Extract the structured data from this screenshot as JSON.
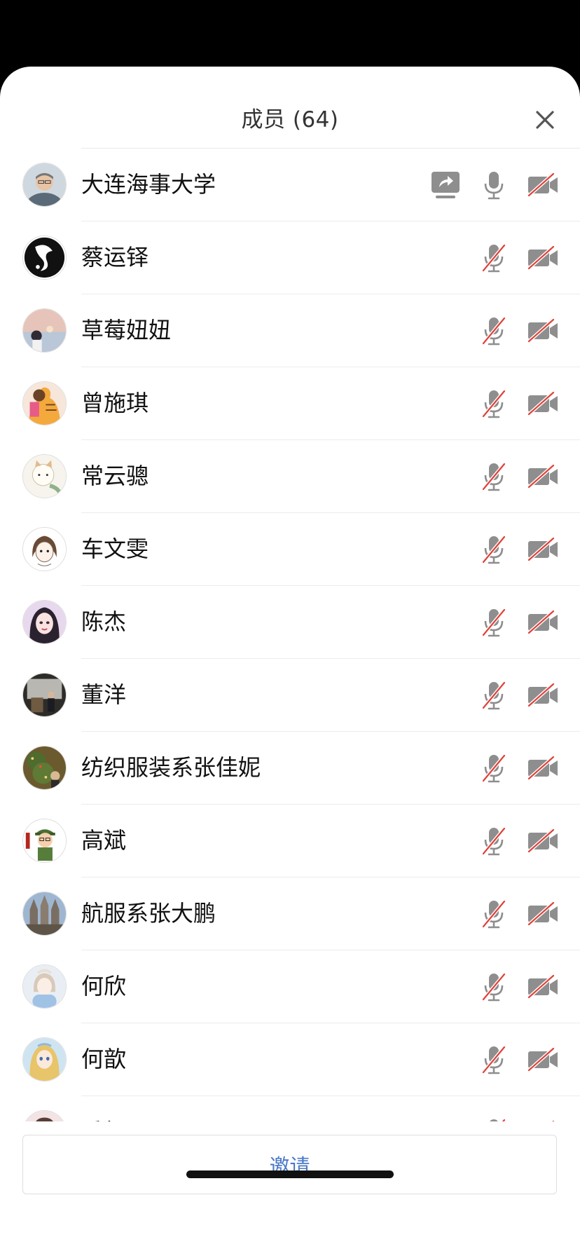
{
  "header": {
    "title": "成员 (64)"
  },
  "members": [
    {
      "name": "大连海事大学",
      "sharing": true,
      "mic_muted": false,
      "camera_off": true,
      "avatar": "avatar-man-glasses"
    },
    {
      "name": "蔡运铎",
      "sharing": false,
      "mic_muted": true,
      "camera_off": true,
      "avatar": "avatar-ink-drawing"
    },
    {
      "name": "草莓妞妞",
      "sharing": false,
      "mic_muted": true,
      "camera_off": true,
      "avatar": "avatar-sunset-girl"
    },
    {
      "name": "曾施琪",
      "sharing": false,
      "mic_muted": true,
      "camera_off": true,
      "avatar": "avatar-cartoon-tiger"
    },
    {
      "name": "常云骢",
      "sharing": false,
      "mic_muted": true,
      "camera_off": true,
      "avatar": "avatar-cartoon-cat"
    },
    {
      "name": "车文雯",
      "sharing": false,
      "mic_muted": true,
      "camera_off": true,
      "avatar": "avatar-sketch-girl"
    },
    {
      "name": "陈杰",
      "sharing": false,
      "mic_muted": true,
      "camera_off": true,
      "avatar": "avatar-illustrated-woman"
    },
    {
      "name": "董洋",
      "sharing": false,
      "mic_muted": true,
      "camera_off": true,
      "avatar": "avatar-lecture-room"
    },
    {
      "name": "纺织服装系张佳妮",
      "sharing": false,
      "mic_muted": true,
      "camera_off": true,
      "avatar": "avatar-christmas-tree"
    },
    {
      "name": "高斌",
      "sharing": false,
      "mic_muted": true,
      "camera_off": true,
      "avatar": "avatar-cartoon-soldier"
    },
    {
      "name": "航服系张大鹏",
      "sharing": false,
      "mic_muted": true,
      "camera_off": true,
      "avatar": "avatar-cathedral"
    },
    {
      "name": "何欣",
      "sharing": false,
      "mic_muted": true,
      "camera_off": true,
      "avatar": "avatar-girl-blue"
    },
    {
      "name": "何歆",
      "sharing": false,
      "mic_muted": true,
      "camera_off": true,
      "avatar": "avatar-anime-princess"
    },
    {
      "name": "季权",
      "sharing": false,
      "mic_muted": true,
      "camera_off": true,
      "avatar": "avatar-partial"
    }
  ],
  "footer": {
    "invite_label": "邀请"
  },
  "colors": {
    "accent": "#4a78c6",
    "icon_gray": "#8e8e8e",
    "muted_red": "#e0413a"
  }
}
